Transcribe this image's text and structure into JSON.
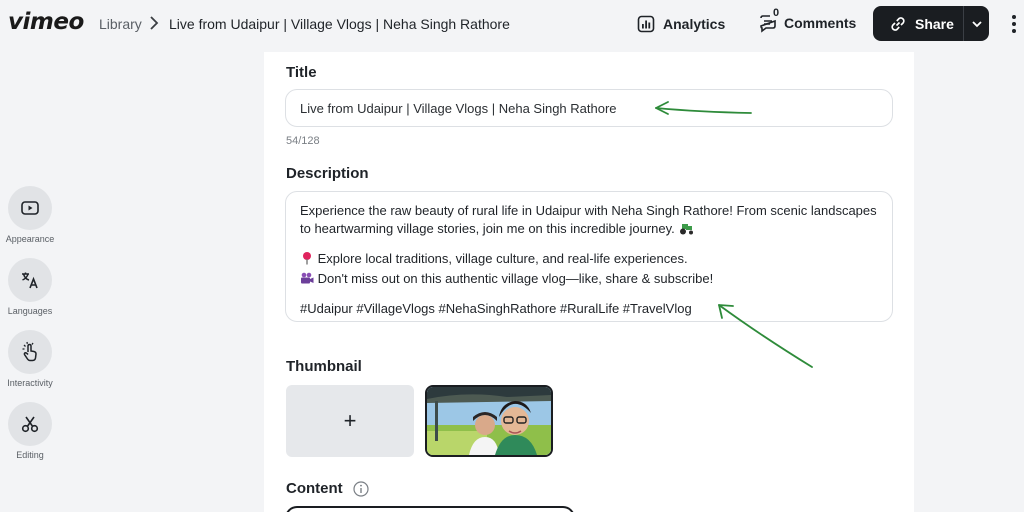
{
  "header": {
    "logo": "vimeo",
    "breadcrumb_library": "Library",
    "breadcrumb_title": "Live from Udaipur | Village Vlogs | Neha Singh Rathore",
    "analytics_label": "Analytics",
    "comments_label": "Comments",
    "comments_count": "0",
    "share_label": "Share"
  },
  "sidebar": {
    "items": [
      {
        "label": "Appearance",
        "icon": "play-square-icon"
      },
      {
        "label": "Languages",
        "icon": "translate-icon"
      },
      {
        "label": "Interactivity",
        "icon": "tap-icon"
      },
      {
        "label": "Editing",
        "icon": "scissors-icon"
      }
    ]
  },
  "form": {
    "title_label": "Title",
    "title_value": "Live from Udaipur | Village Vlogs | Neha Singh Rathore",
    "title_counter": "54/128",
    "description_label": "Description",
    "description": {
      "line1": "Experience the raw beauty of rural life in Udaipur with Neha Singh Rathore! From scenic landscapes to heartwarming village stories, join me on this incredible journey.",
      "line2": "Explore local traditions, village culture, and real-life experiences.",
      "line3": "Don't miss out on this authentic village vlog—like, share & subscribe!",
      "hashtags": "#Udaipur #VillageVlogs #NehaSinghRathore #RuralLife #TravelVlog"
    },
    "thumbnail_label": "Thumbnail",
    "thumbnail_add": "+",
    "content_label": "Content"
  },
  "colors": {
    "accent_dark": "#1a1d21",
    "annotation_green": "#2e8b3a",
    "background": "#f3f4f6"
  }
}
